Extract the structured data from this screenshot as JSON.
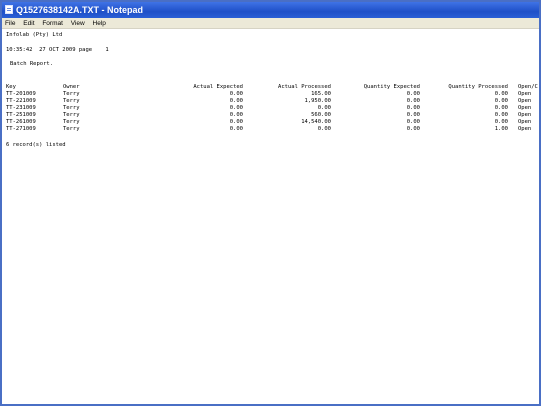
{
  "window": {
    "title": "Q1527638142A.TXT - Notepad"
  },
  "menu": [
    "File",
    "Edit",
    "Format",
    "View",
    "Help"
  ],
  "report": {
    "company": "Infolab (Pty) Ltd",
    "timestamp_line": "10:35:42  27 OCT 2009 page    1",
    "report_title": "Batch Report.",
    "headers": {
      "key": "Key",
      "owner": "Owner",
      "actual_expected": "Actual Expected",
      "actual_processed": "Actual Processed",
      "quantity_expected": "Quantity Expected",
      "quantity_processed": "Quantity Processed",
      "open_closed": "Open/C"
    },
    "rows": [
      [
        "TT-201009",
        "Terry",
        "0.00",
        "165.00",
        "0.00",
        "0.00",
        "Open"
      ],
      [
        "TT-221009",
        "Terry",
        "0.00",
        "1,950.00",
        "0.00",
        "0.00",
        "Open"
      ],
      [
        "TT-231009",
        "Terry",
        "0.00",
        "0.00",
        "0.00",
        "0.00",
        "Open"
      ],
      [
        "TT-251009",
        "Terry",
        "0.00",
        "560.00",
        "0.00",
        "0.00",
        "Open"
      ],
      [
        "TT-261009",
        "Terry",
        "0.00",
        "14,540.00",
        "0.00",
        "0.00",
        "Open"
      ],
      [
        "TT-271009",
        "Terry",
        "0.00",
        "0.00",
        "0.00",
        "1.00",
        "Open"
      ]
    ],
    "footer": "6 record(s) listed"
  }
}
